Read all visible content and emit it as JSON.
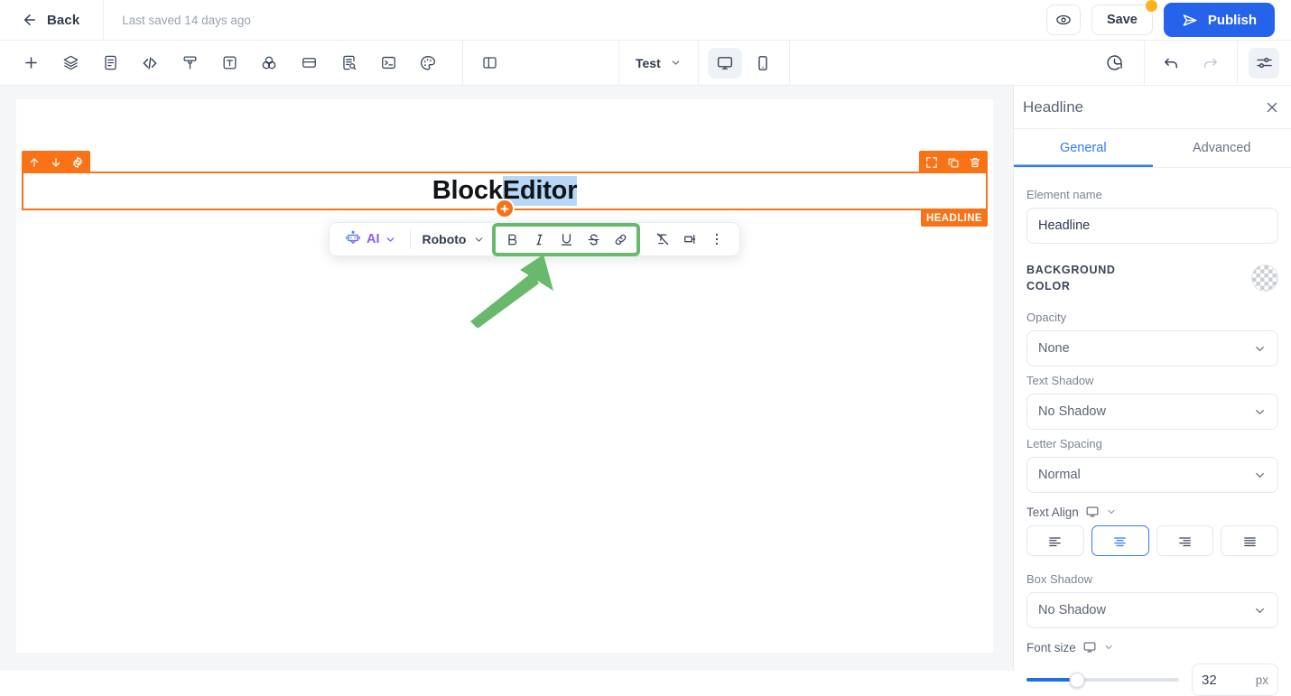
{
  "topbar": {
    "back_label": "Back",
    "back_icon": "arrow-left-icon",
    "saved_text": "Last saved 14 days ago",
    "preview_icon": "eye-icon",
    "save_label": "Save",
    "save_badge": "unsaved-changes-dot",
    "publish_label": "Publish",
    "publish_icon": "send-icon",
    "publish_color": "#2563eb"
  },
  "toolbar": {
    "icons": [
      "plus-icon",
      "layers-icon",
      "page-icon",
      "code-icon",
      "brush-icon",
      "text-box-icon",
      "color-blend-icon",
      "card-icon",
      "document-search-icon",
      "terminal-icon",
      "palette-icon"
    ],
    "panel_toggle_icon": "split-panel-icon",
    "preset_label": "Test",
    "preset_chevron": "chevron-down-icon",
    "devices": [
      {
        "name": "desktop-icon",
        "active": true
      },
      {
        "name": "mobile-icon",
        "active": false
      }
    ],
    "history_icon": "revision-history-icon",
    "undo_icon": "undo-icon",
    "redo_icon": "redo-icon",
    "settings_icon": "sliders-icon"
  },
  "canvas": {
    "block": {
      "type_label": "HEADLINE",
      "selection_color": "#f97316",
      "handles_left": [
        "move-up-icon",
        "move-down-icon",
        "block-settings-icon"
      ],
      "handles_right": [
        "expand-icon",
        "duplicate-icon",
        "delete-icon"
      ],
      "add_button": "+",
      "headline_text_plain": "Block ",
      "headline_text_selected": "Editor",
      "highlight_color": "#b6d7f5"
    }
  },
  "float_toolbar": {
    "ai_icon": "ai-robot-icon",
    "ai_label": "AI",
    "ai_chevron": "chevron-down-icon",
    "font_label": "Roboto",
    "font_chevron": "chevron-down-icon",
    "highlighted_group_color": "#69b96d",
    "format_buttons": [
      {
        "name": "bold-icon",
        "glyph": "B"
      },
      {
        "name": "italic-icon",
        "glyph": "I"
      },
      {
        "name": "underline-icon",
        "glyph": "U"
      },
      {
        "name": "strikethrough-icon",
        "glyph": "S"
      },
      {
        "name": "link-icon",
        "glyph": "link"
      }
    ],
    "tail_buttons": [
      "clear-formatting-icon",
      "inline-element-icon",
      "more-options-icon"
    ]
  },
  "annotation": {
    "arrow_color": "#69b96d",
    "arrow_name": "green-pointer-arrow"
  },
  "panel": {
    "title": "Headline",
    "close_icon": "close-icon",
    "tabs": [
      {
        "label": "General",
        "active": true
      },
      {
        "label": "Advanced",
        "active": false
      }
    ],
    "element_name_label": "Element name",
    "element_name_value": "Headline",
    "background_color_label": "Background Color",
    "background_color_swatch": "transparent-checker",
    "opacity_label": "Opacity",
    "opacity_value": "None",
    "text_shadow_label": "Text Shadow",
    "text_shadow_value": "No Shadow",
    "letter_spacing_label": "Letter Spacing",
    "letter_spacing_value": "Normal",
    "text_align_label": "Text Align",
    "text_align_device_icon": "desktop-icon",
    "text_align_options": [
      {
        "name": "align-left-button",
        "active": false
      },
      {
        "name": "align-center-button",
        "active": true
      },
      {
        "name": "align-right-button",
        "active": false
      },
      {
        "name": "align-justify-button",
        "active": false
      }
    ],
    "box_shadow_label": "Box Shadow",
    "box_shadow_value": "No Shadow",
    "font_size_label": "Font size",
    "font_size_device_icon": "desktop-icon",
    "font_size_value": "32",
    "font_size_unit": "px"
  }
}
